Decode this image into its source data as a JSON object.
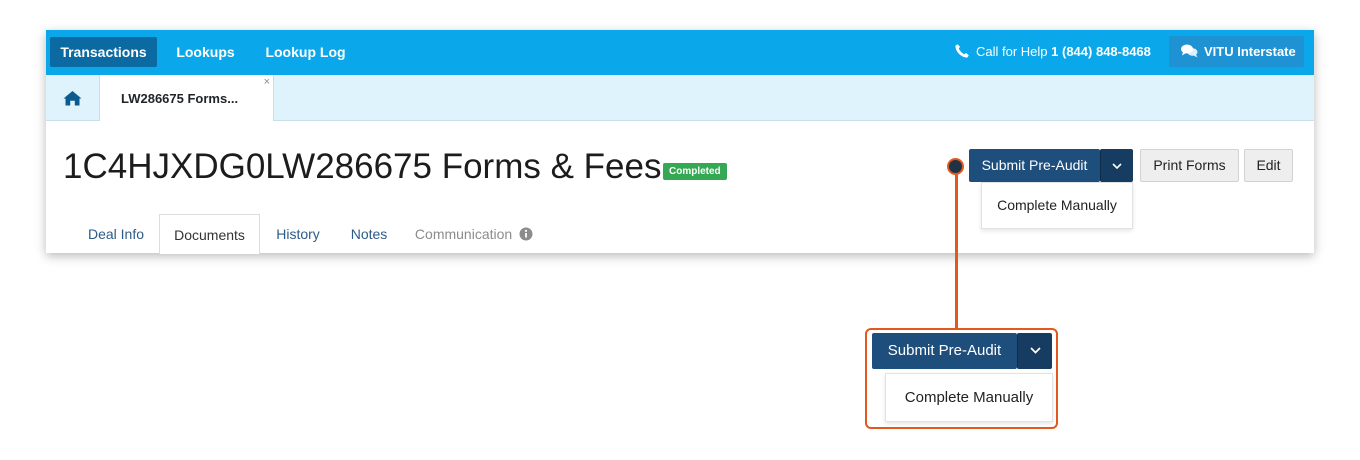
{
  "nav": {
    "items": [
      {
        "label": "Transactions",
        "active": true
      },
      {
        "label": "Lookups",
        "active": false
      },
      {
        "label": "Lookup Log",
        "active": false
      }
    ],
    "help_label": "Call for Help",
    "help_phone": "1 (844) 848-8468",
    "account_label": "VITU Interstate"
  },
  "tabs": {
    "home_icon": "home-icon",
    "open_tab_label": "LW286675 Forms...",
    "close_glyph": "×"
  },
  "header": {
    "title": "1C4HJXDG0LW286675 Forms & Fees",
    "status": "Completed",
    "status_color": "#34a853"
  },
  "actions": {
    "submit_label": "Submit Pre-Audit",
    "print_label": "Print Forms",
    "edit_label": "Edit",
    "dropdown_item": "Complete Manually"
  },
  "subtabs": [
    {
      "label": "Deal Info"
    },
    {
      "label": "Documents",
      "active": true
    },
    {
      "label": "History"
    },
    {
      "label": "Notes"
    },
    {
      "label": "Communication",
      "disabled": true
    }
  ],
  "callout": {
    "submit_label": "Submit Pre-Audit",
    "dropdown_item": "Complete Manually",
    "accent_color": "#e1591e"
  },
  "colors": {
    "nav_bg": "#0aa8ea",
    "nav_active": "#0b6aa1",
    "primary_button": "#1e4e7c"
  }
}
